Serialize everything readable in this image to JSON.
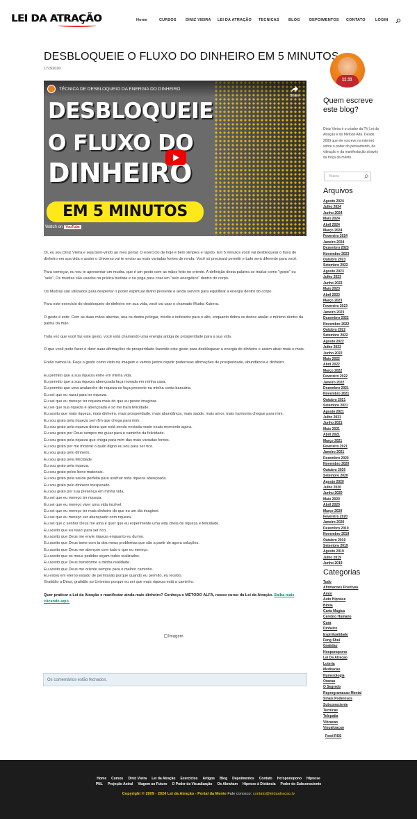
{
  "site": {
    "logo": "LEI DA ATRAÇÃO"
  },
  "nav": [
    "Home",
    "CURSOS",
    "DINIZ VIEIRA",
    "LEI DA ATRAÇÃO",
    "TECNICAS",
    "BLOG",
    "DEPOIMENTOS",
    "CONTATO",
    "LOGIN"
  ],
  "icons": {
    "search": "search-icon",
    "share": "share-icon",
    "play": "youtube-play-icon"
  },
  "post": {
    "title": "DESBLOQUEIE O FLUXO DO DINHEIRO EM 5 MINUTOS",
    "date": "17/3/2020",
    "video": {
      "title": "TÉCNICA DE DESBLOQUEIO DA ENERGIA DO DINHEIRO",
      "share": "Share",
      "line1": "DESBLOQUEIE",
      "line2": "O FLUXO DO",
      "line3": "DINHEIRO",
      "banner": "EM 5 MINUTOS",
      "watch": "Watch on",
      "yt": "YouTube"
    },
    "paragraphs": [
      "Oi, eu sou Diniz Vieira e seja bem-vindo ao meu portal. O exercício de hoje é bem simples e rápido. Em 5 minutos você vai desbloquear o fluxo de dinheiro em sua vida e assim o Universo vai te enviar as mais variadas fontes de renda. Você só precisará permitir e tudo será diferente para você.",
      "Para começar, eu vou te apresentar um mudra, que é um gesto com as mãos feito no oriente. A definição desta palavra se traduz como “gesto” ou “selo”. Os mudras são usados na prática budista e na yoga para criar um “selo energético” dentro do corpo.",
      "Os Mudras são utilizados para despertar o poder espiritual divino presente e ainda servem para equilibrar a energia dentro do corpo.",
      "Para este exercício do desbloqueio do dinheiro em sua vida, você vai usar o chamado Mudra Kubera.",
      "O gesto é este: Com as duas mãos abertas, una os dedos polegar, médio e indicador para o alto, enquanto dobra os dedos anular e mínimo dentro da palma da mão.",
      "Toda vez que você faz este gesto, você está chamando uma energia antiga de prosperidade para a sua vida.",
      "O que você pode fazer é dizer suas afirmações de prosperidade fazendo este gesto para desbloquear a energia do dinheiro e assim atrair mais e mais.",
      "Então vamos lá. Faça o gesto como visto na imagem e vamos juntos repetir poderosas afirmações de prosperidade, abundância e dinheiro:"
    ],
    "affirmations": [
      "Eu permito que a sua riqueza entre em minha vida.",
      "Eu permito que a sua riqueza abençoada faça morada em minha casa.",
      "Eu permito que uma avalanche de riqueza se faça presente na minha conta bancária.",
      "Eu sei que eu nasci para ter riqueza.",
      "Eu sei que eu mereço ter riqueza mais do que eu posso imaginar.",
      "Eu sei que sua riqueza é abençoada e só me trará felicidade.",
      "Eu aceito que mais riqueza, mais dinheiro, mais prosperidade, mais abundância, mais saúde, mais amor, mais harmonia chegue para mim.",
      "Eu sou grato pela riqueza sem fim que chega para mim.",
      "Eu sou grato pela riqueza divina que está sendo enviada neste exato momento agora.",
      "Eu sou grato por Deus sempre me guiar para o caminho da felicidade.",
      "Eu sou grato pela riqueza que chega para mim das mais variadas fontes.",
      "Eu sou grato por me mostrar o quão digno eu sou para ser rico.",
      "Eu sou grato pelo dinheiro.",
      "Eu sou grato pela felicidade.",
      "Eu sou grato pela riqueza.",
      "Eu sou grato pelos bens materiais.",
      "Eu sou grato pela saúde perfeita para usufruir toda riqueza abençoada.",
      "Eu sou grato pelo dinheiro inesperado.",
      "Eu sou grato por sua presença em minha vida.",
      "Eu sei que eu mereço ter riqueza.",
      "Eu sei que eu mereço viver uma vida incrível.",
      "Eu sei que eu mereço ter mais dinheiro do que eu um dia imaginei.",
      "Eu sei que eu mereço ser abençoado com riqueza.",
      "Eu sei que o senhor Deus me ama e quer que eu experimente uma vida cheia de riqueza e felicidade.",
      "Eu aceito que eu nasci para ser rico.",
      "Eu aceito que Deus me envie riqueza enquanto eu durmo.",
      "Eu aceito que Deus tome com ta dos meus problemas que são a partir de agora soluções.",
      "Eu aceito que Deus me abençoe com tudo o que eu mereço.",
      "Eu aceito que os meus pedidos sejam todos realizados.",
      "Eu aceito que Deus transforme a minha realidade.",
      "Eu aceito que Deus me oriente sempre para o melhor caminho.",
      "Eu estou em eterno estado de permissão porque quando eu permito, eu recebo.",
      "Gratidão a Deus, gratidão ao Universo porque eu sei que mais riqueza está a caminho."
    ],
    "cta": "Quer praticar a Lei da Atração e manifestar ainda mais dinheiro? Conheça o MÉTODO ALFA, nosso curso da Lei da Atração.",
    "cta_link": "Saiba mais clicando aqui.",
    "image_alt": "Imagem",
    "comments_closed": "Os comentários estão fechados."
  },
  "sidebar": {
    "avatar_text": "11:11",
    "who_title": "Quem escreve este blog?",
    "about": "Diniz Vieira é o criador da TV Lei da Atração e do Método Alfa. Desde 2009 que ele escreve na internet sobre o poder do pensamento, da vibração e da manifestação através da força da mente.",
    "search_placeholder": "Busca",
    "archives_title": "Arquivos",
    "archives": [
      "Agosto 2024",
      "Julho 2024",
      "Junho 2024",
      "Maio 2024",
      "Abril 2024",
      "Março 2024",
      "Fevereiro 2024",
      "Janeiro 2024",
      "Dezembro 2023",
      "Novembro 2023",
      "Outubro 2023",
      "Setembro 2023",
      "Agosto 2023",
      "Julho 2023",
      "Junho 2023",
      "Maio 2023",
      "Abril 2023",
      "Março 2023",
      "Fevereiro 2023",
      "Janeiro 2023",
      "Dezembro 2022",
      "Novembro 2022",
      "Outubro 2022",
      "Setembro 2022",
      "Agosto 2022",
      "Julho 2022",
      "Junho 2022",
      "Maio 2022",
      "Abril 2022",
      "Março 2022",
      "Fevereiro 2022",
      "Janeiro 2022",
      "Dezembro 2021",
      "Novembro 2021",
      "Outubro 2021",
      "Setembro 2021",
      "Agosto 2021",
      "Julho 2021",
      "Junho 2021",
      "Maio 2021",
      "Abril 2021",
      "Março 2021",
      "Fevereiro 2021",
      "Janeiro 2021",
      "Dezembro 2020",
      "Novembro 2020",
      "Outubro 2020",
      "Setembro 2020",
      "Agosto 2020",
      "Julho 2020",
      "Junho 2020",
      "Maio 2020",
      "Abril 2020",
      "Março 2020",
      "Fevereiro 2020",
      "Janeiro 2020",
      "Dezembro 2019",
      "Novembro 2019",
      "Outubro 2019",
      "Setembro 2019",
      "Agosto 2019",
      "Julho 2019",
      "Junho 2019"
    ],
    "categories_title": "Categorias",
    "categories": [
      "Tudo",
      "Afirmacoes Positivas",
      "Amor",
      "Auto Hipnose",
      "Bíblia",
      "Carta Magica",
      "Cerebro Humano",
      "Cura",
      "Dinheiro",
      "Espiritualidade",
      "Feng Shui",
      "Gratidao",
      "Hooponopono",
      "Lei Da Atracao",
      "Loteria",
      "Meditacao",
      "Numerologia",
      "Oracao",
      "O Segredo",
      "Reprogramacao Mental",
      "Sinais Poderosos",
      "Subconsciente",
      "Tecnicas",
      "Telepatia",
      "Vibracao",
      "Visualizacao"
    ],
    "feed": "Feed RSS"
  },
  "footer": {
    "row1": [
      "Home",
      "Cursos",
      "Diniz Vieira",
      "Lei da Atração",
      "Exercícios",
      "Artigos",
      "Blog",
      "Depoimentos",
      "Contato",
      "Ho'oponopono",
      "Hipnose"
    ],
    "row2": [
      "PNL",
      "Projeção Astral",
      "Viagem ao Futuro",
      "O Poder da Visualização",
      "Os Abraham",
      "Hipnose à Distância",
      "Poder do Subconsciente"
    ],
    "copyright": "Copyright © 2009 - 2024 Lei da Atração - Portal da Mente",
    "contact_label": "Fale conosco:",
    "email": "contato@leidaatracao.tv"
  },
  "colors": {
    "accent": "#f1c40f",
    "link": "#0a8f7a",
    "footer_bg": "#1c1c1c",
    "comments_bg": "#e8eff5"
  }
}
